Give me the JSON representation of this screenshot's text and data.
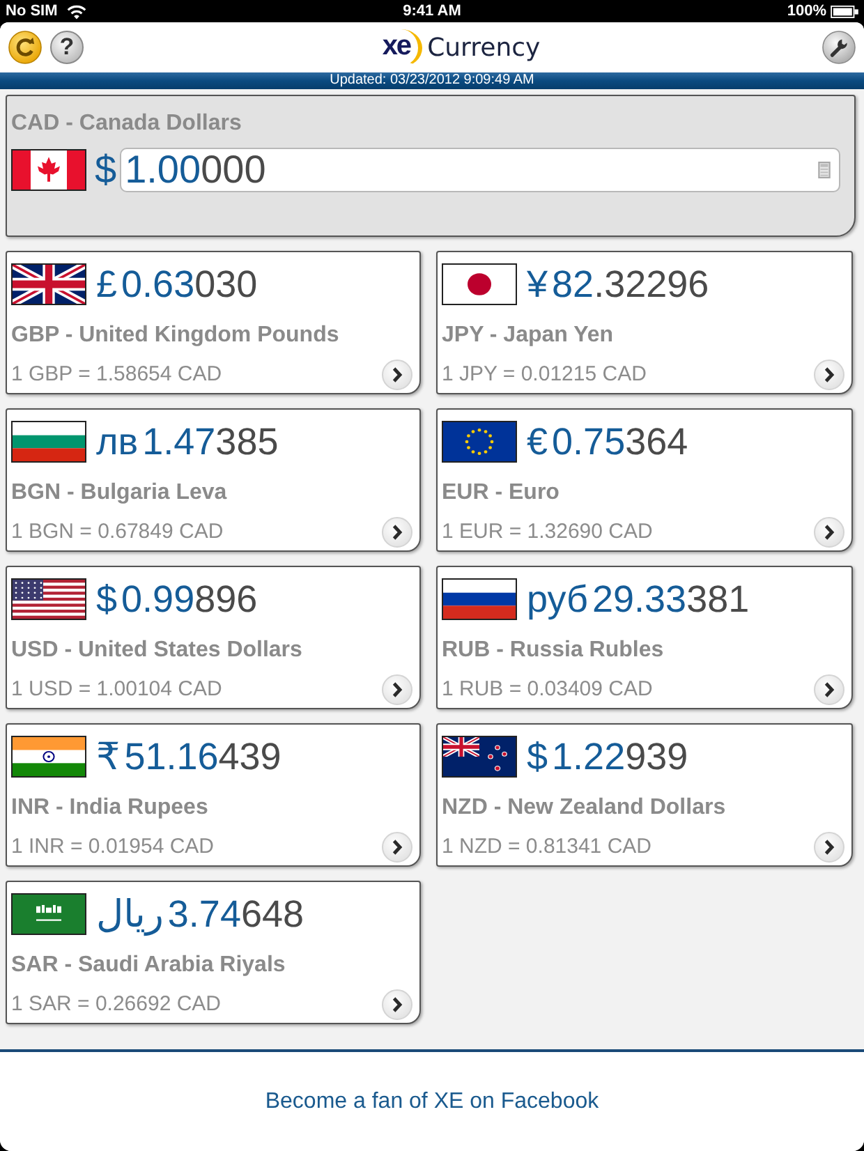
{
  "status_bar": {
    "carrier": "No SIM",
    "time": "9:41 AM",
    "battery": "100%"
  },
  "header": {
    "help_label": "?",
    "logo": "xe",
    "title": "Currency"
  },
  "updated": "Updated: 03/23/2012 9:09:49 AM",
  "base_currency": {
    "label": "CAD - Canada Dollars",
    "kind": "ca",
    "symbol": "$",
    "value_main": "1.00",
    "value_rest": "000"
  },
  "currencies": [
    {
      "kind": "gb",
      "symbol": "£",
      "amount_main": "0.63",
      "amount_rest": "030",
      "name": "GBP - United Kingdom Pounds",
      "rate": "1 GBP = 1.58654 CAD"
    },
    {
      "kind": "jp",
      "symbol": "¥",
      "amount_main": "82",
      "amount_rest": ".32296",
      "name": "JPY - Japan Yen",
      "rate": "1 JPY = 0.01215 CAD"
    },
    {
      "kind": "bg",
      "symbol": "лв",
      "amount_main": "1.47",
      "amount_rest": "385",
      "name": "BGN - Bulgaria Leva",
      "rate": "1 BGN = 0.67849 CAD"
    },
    {
      "kind": "eu",
      "symbol": "€",
      "amount_main": "0.75",
      "amount_rest": "364",
      "name": "EUR - Euro",
      "rate": "1 EUR = 1.32690 CAD"
    },
    {
      "kind": "us",
      "symbol": "$",
      "amount_main": "0.99",
      "amount_rest": "896",
      "name": "USD - United States Dollars",
      "rate": "1 USD = 1.00104 CAD"
    },
    {
      "kind": "ru",
      "symbol": "руб",
      "amount_main": "29.33",
      "amount_rest": "381",
      "name": "RUB - Russia Rubles",
      "rate": "1 RUB = 0.03409 CAD"
    },
    {
      "kind": "in",
      "symbol": "₹",
      "amount_main": "51.16",
      "amount_rest": "439",
      "name": "INR - India Rupees",
      "rate": "1 INR = 0.01954 CAD"
    },
    {
      "kind": "nz",
      "symbol": "$",
      "amount_main": "1.22",
      "amount_rest": "939",
      "name": "NZD - New Zealand Dollars",
      "rate": "1 NZD = 0.81341 CAD"
    },
    {
      "kind": "sa",
      "symbol": "ريال",
      "amount_main": "3.74",
      "amount_rest": "648",
      "name": "SAR - Saudi Arabia Riyals",
      "rate": "1 SAR = 0.26692 CAD"
    }
  ],
  "footer": {
    "link": "Become a fan of XE on Facebook"
  }
}
